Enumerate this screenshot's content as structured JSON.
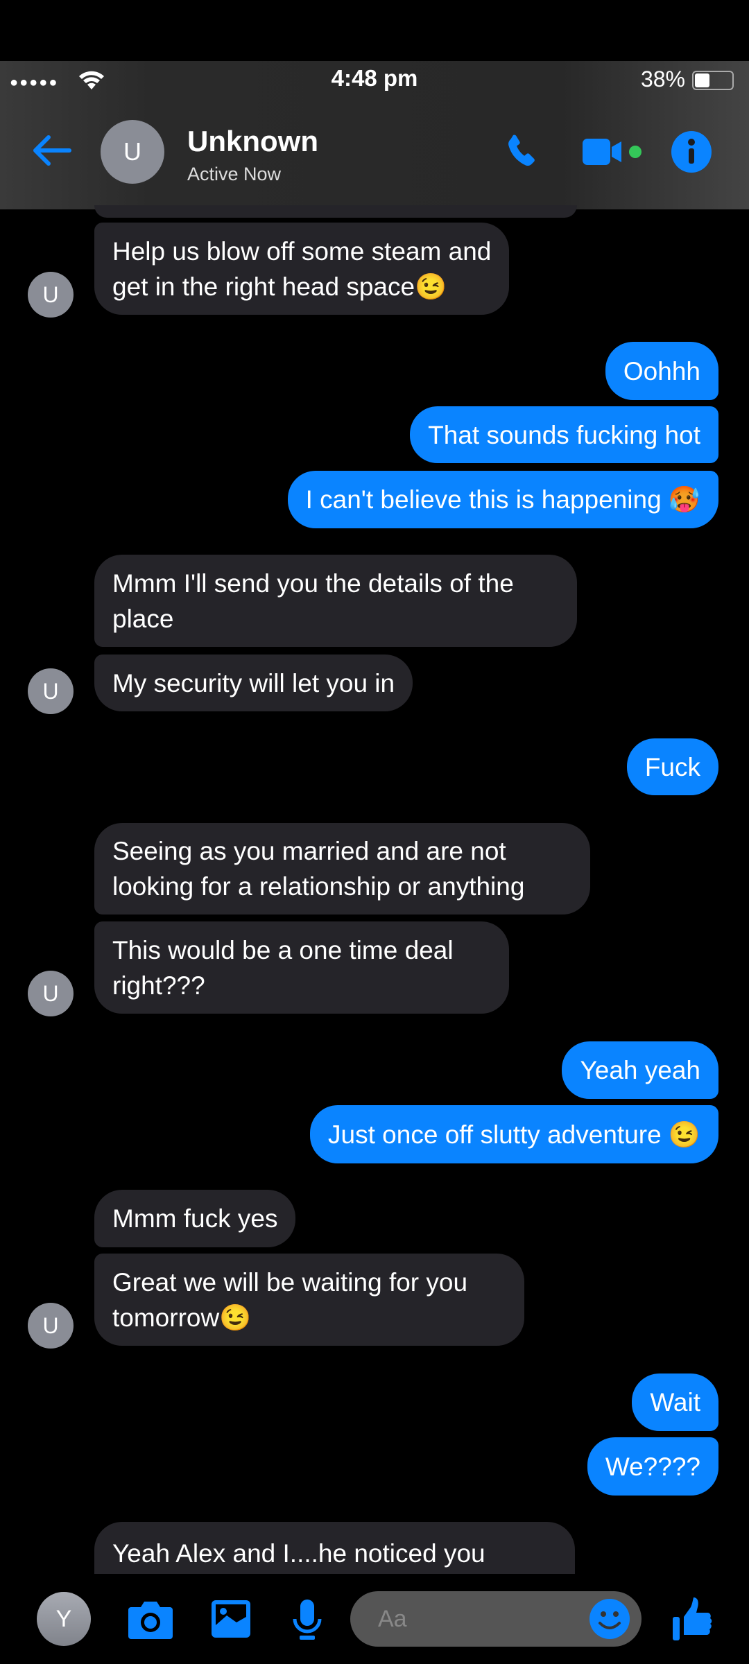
{
  "status_bar": {
    "time": "4:48 pm",
    "battery": "38%",
    "battery_level": 0.38,
    "signal_dots": "●●●●●"
  },
  "header": {
    "avatar_letter": "U",
    "title": "Unknown",
    "subtitle": "Active Now"
  },
  "colors": {
    "accent": "#0a84ff",
    "incoming_bubble": "#252429",
    "active_dot": "#34c759",
    "avatar": "#8a8d96"
  },
  "messages": [
    {
      "side": "in",
      "text": "Help us blow off some steam and\nget in the right head space😉"
    },
    {
      "side": "out",
      "text": "Oohhh"
    },
    {
      "side": "out",
      "text": "That sounds fucking hot"
    },
    {
      "side": "out",
      "text": "I can't believe this is happening 🥵"
    },
    {
      "side": "in",
      "text": "Mmm I'll send you the details of the\nplace"
    },
    {
      "side": "in",
      "text": "My security will let you in"
    },
    {
      "side": "out",
      "text": "Fuck"
    },
    {
      "side": "in",
      "text": "Seeing as you married and are not\nlooking for a relationship or anything"
    },
    {
      "side": "in",
      "text": "This would be a one time deal\nright???"
    },
    {
      "side": "out",
      "text": "Yeah yeah"
    },
    {
      "side": "out",
      "text": "Just once off slutty adventure 😉"
    },
    {
      "side": "in",
      "text": "Mmm fuck yes"
    },
    {
      "side": "in",
      "text": "Great we will be waiting for you\ntomorrow😉"
    },
    {
      "side": "out",
      "text": "Wait"
    },
    {
      "side": "out",
      "text": "We????"
    },
    {
      "side": "in",
      "text": "Yeah Alex and I....he noticed you"
    }
  ],
  "sender_avatar_letter": "U",
  "composer": {
    "avatar_letter": "Y",
    "placeholder": "Aa"
  }
}
